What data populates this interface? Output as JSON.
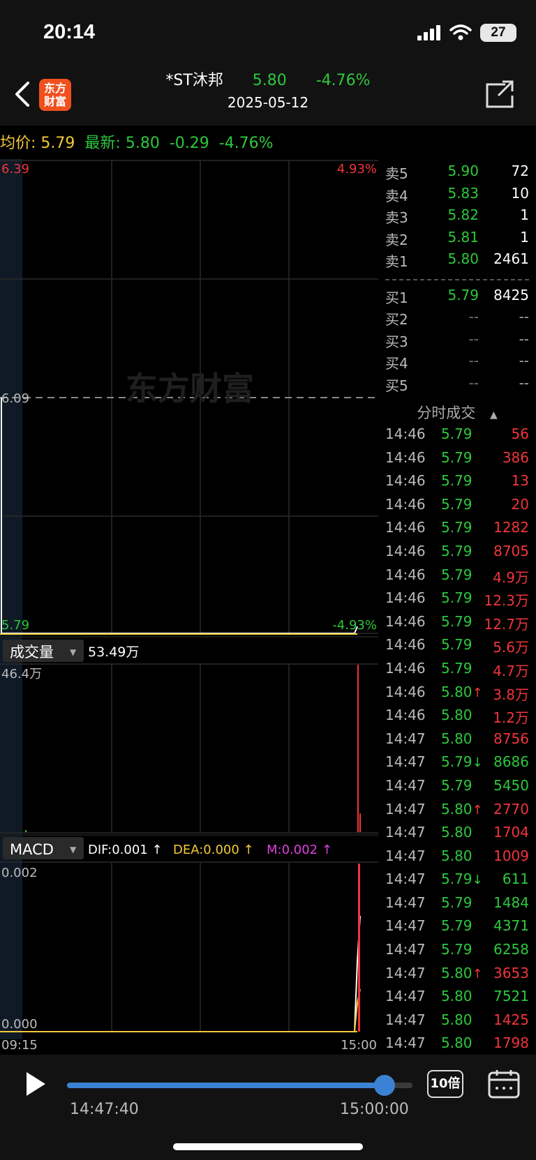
{
  "status": {
    "time": "20:14",
    "battery": "27"
  },
  "nav": {
    "stock_name": "*ST沐邦",
    "price": "5.80",
    "change_pct": "-4.76%",
    "date": "2025-05-12",
    "logo_line1": "东方",
    "logo_line2": "财富"
  },
  "info": {
    "avg_label": "均价:",
    "avg_value": "5.79",
    "latest_label": "最新:",
    "latest_value": "5.80",
    "change": "-0.29",
    "change_pct": "-4.76%"
  },
  "price_chart": {
    "high_label": "6.39",
    "mid_label": "6.09",
    "low_label": "5.79",
    "high_pct": "4.93%",
    "low_pct": "-4.93%",
    "watermark": "东方财富"
  },
  "volume": {
    "selector": "成交量",
    "total": "53.49万",
    "max_label": "46.4万"
  },
  "macd": {
    "selector": "MACD",
    "dif": "DIF:0.001 ↑",
    "dea": "DEA:0.000 ↑",
    "m": "M:0.002 ↑",
    "max_label": "0.002",
    "zero_label": "0.000"
  },
  "time_axis": {
    "start": "09:15",
    "end": "15:00"
  },
  "order_book": {
    "sell": [
      {
        "label": "卖5",
        "price": "5.90",
        "vol": "72"
      },
      {
        "label": "卖4",
        "price": "5.83",
        "vol": "10"
      },
      {
        "label": "卖3",
        "price": "5.82",
        "vol": "1"
      },
      {
        "label": "卖2",
        "price": "5.81",
        "vol": "1"
      },
      {
        "label": "卖1",
        "price": "5.80",
        "vol": "2461"
      }
    ],
    "buy": [
      {
        "label": "买1",
        "price": "5.79",
        "vol": "8425"
      },
      {
        "label": "买2",
        "price": "--",
        "vol": "--"
      },
      {
        "label": "买3",
        "price": "--",
        "vol": "--"
      },
      {
        "label": "买4",
        "price": "--",
        "vol": "--"
      },
      {
        "label": "买5",
        "price": "--",
        "vol": "--"
      }
    ]
  },
  "trades_header": "分时成交",
  "trades": [
    {
      "time": "14:46",
      "price": "5.79",
      "arrow": "",
      "vol": "56",
      "color": "red"
    },
    {
      "time": "14:46",
      "price": "5.79",
      "arrow": "",
      "vol": "386",
      "color": "red"
    },
    {
      "time": "14:46",
      "price": "5.79",
      "arrow": "",
      "vol": "13",
      "color": "red"
    },
    {
      "time": "14:46",
      "price": "5.79",
      "arrow": "",
      "vol": "20",
      "color": "red"
    },
    {
      "time": "14:46",
      "price": "5.79",
      "arrow": "",
      "vol": "1282",
      "color": "red"
    },
    {
      "time": "14:46",
      "price": "5.79",
      "arrow": "",
      "vol": "8705",
      "color": "red"
    },
    {
      "time": "14:46",
      "price": "5.79",
      "arrow": "",
      "vol": "4.9万",
      "color": "red"
    },
    {
      "time": "14:46",
      "price": "5.79",
      "arrow": "",
      "vol": "12.3万",
      "color": "red"
    },
    {
      "time": "14:46",
      "price": "5.79",
      "arrow": "",
      "vol": "12.7万",
      "color": "red"
    },
    {
      "time": "14:46",
      "price": "5.79",
      "arrow": "",
      "vol": "5.6万",
      "color": "red"
    },
    {
      "time": "14:46",
      "price": "5.79",
      "arrow": "",
      "vol": "4.7万",
      "color": "red"
    },
    {
      "time": "14:46",
      "price": "5.80",
      "arrow": "↑",
      "vol": "3.8万",
      "color": "red"
    },
    {
      "time": "14:46",
      "price": "5.80",
      "arrow": "",
      "vol": "1.2万",
      "color": "red"
    },
    {
      "time": "14:47",
      "price": "5.80",
      "arrow": "",
      "vol": "8756",
      "color": "red"
    },
    {
      "time": "14:47",
      "price": "5.79",
      "arrow": "↓",
      "vol": "8686",
      "color": "green"
    },
    {
      "time": "14:47",
      "price": "5.79",
      "arrow": "",
      "vol": "5450",
      "color": "green"
    },
    {
      "time": "14:47",
      "price": "5.80",
      "arrow": "↑",
      "vol": "2770",
      "color": "red"
    },
    {
      "time": "14:47",
      "price": "5.80",
      "arrow": "",
      "vol": "1704",
      "color": "red"
    },
    {
      "time": "14:47",
      "price": "5.80",
      "arrow": "",
      "vol": "1009",
      "color": "red"
    },
    {
      "time": "14:47",
      "price": "5.79",
      "arrow": "↓",
      "vol": "611",
      "color": "green"
    },
    {
      "time": "14:47",
      "price": "5.79",
      "arrow": "",
      "vol": "1484",
      "color": "green"
    },
    {
      "time": "14:47",
      "price": "5.79",
      "arrow": "",
      "vol": "4371",
      "color": "green"
    },
    {
      "time": "14:47",
      "price": "5.79",
      "arrow": "",
      "vol": "6258",
      "color": "green"
    },
    {
      "time": "14:47",
      "price": "5.80",
      "arrow": "↑",
      "vol": "3653",
      "color": "red"
    },
    {
      "time": "14:47",
      "price": "5.80",
      "arrow": "",
      "vol": "7521",
      "color": "green"
    },
    {
      "time": "14:47",
      "price": "5.80",
      "arrow": "",
      "vol": "1425",
      "color": "red"
    },
    {
      "time": "14:47",
      "price": "5.80",
      "arrow": "",
      "vol": "1798",
      "color": "red"
    }
  ],
  "player": {
    "current_time": "14:47:40",
    "end_time": "15:00:00",
    "speed": "10倍",
    "progress": 0.92
  },
  "colors": {
    "up": "#f0353a",
    "down": "#2dc83c",
    "avg": "#f5c83a",
    "accent": "#3b82d4"
  }
}
